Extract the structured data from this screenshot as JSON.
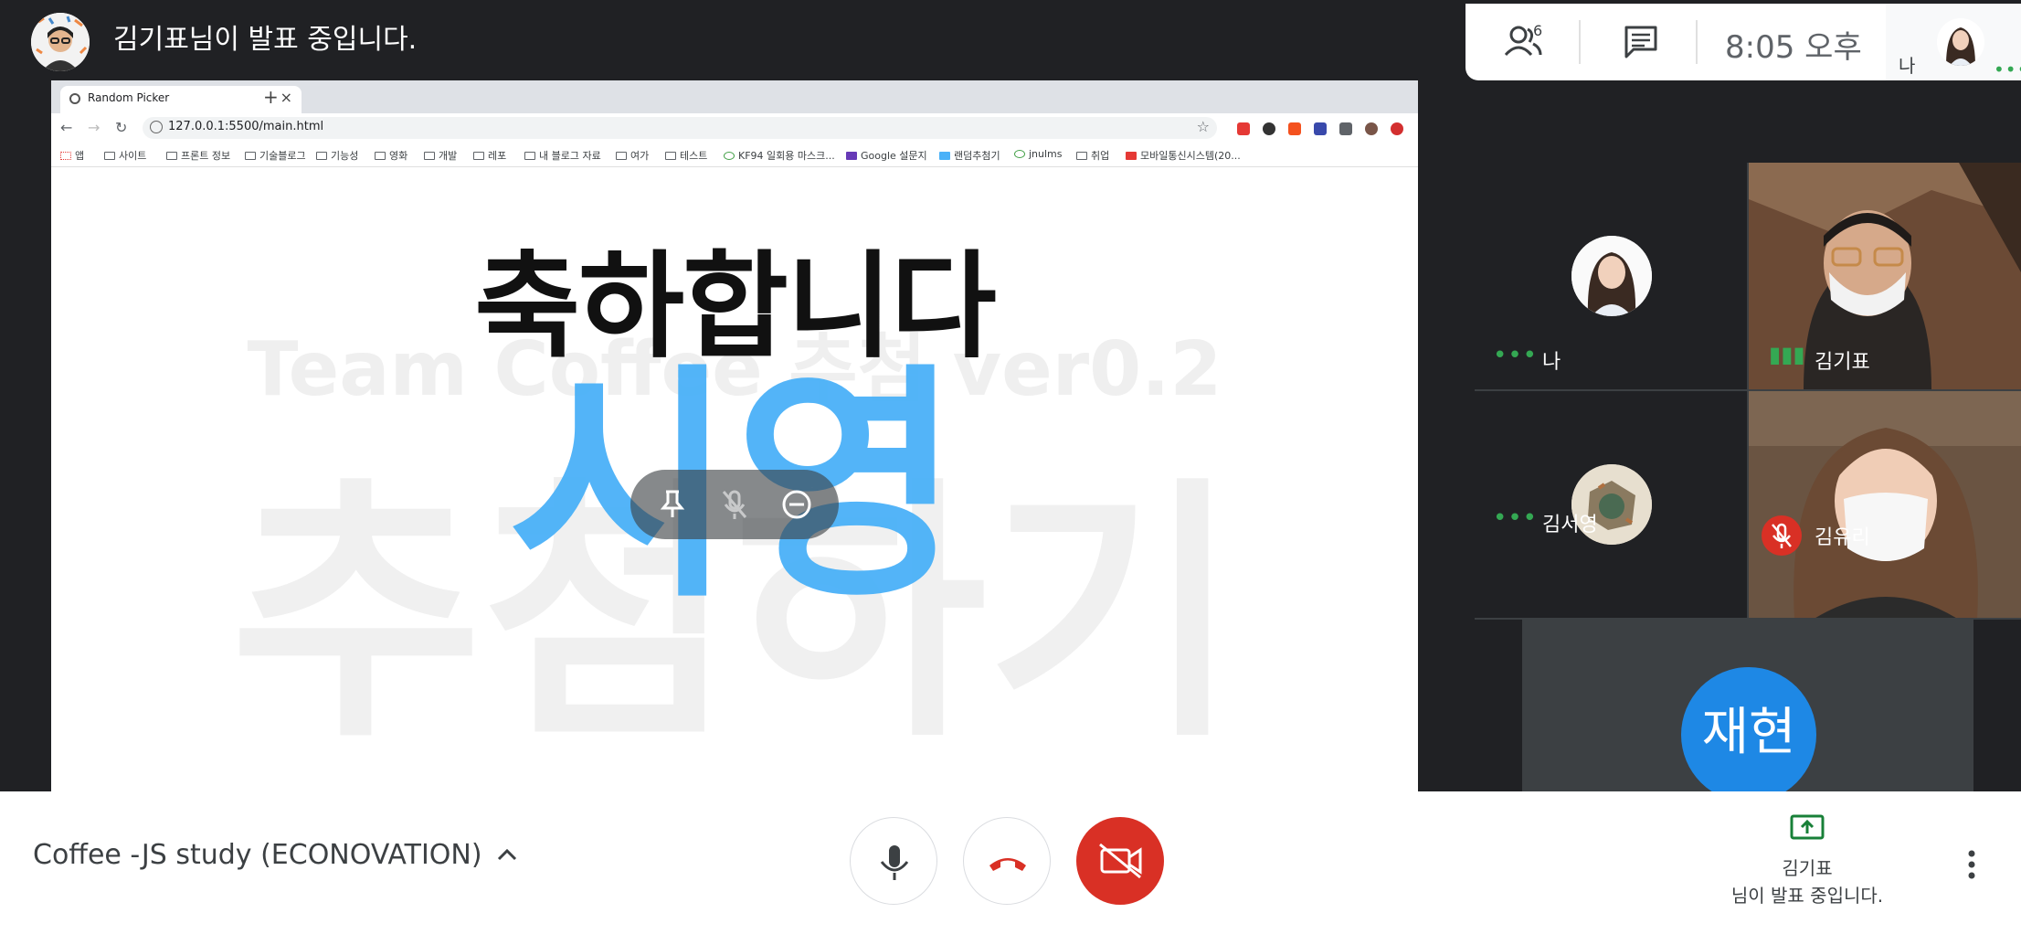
{
  "presenter": {
    "banner": "김기표님이 발표 중입니다."
  },
  "top_panel": {
    "people_count": "6",
    "clock": "8:05 오후",
    "self_label": "나"
  },
  "browser": {
    "tab_title": "Random Picker",
    "tab_close": "×",
    "new_tab": "+",
    "url": "127.0.0.1:5500/main.html",
    "bookmarks": [
      "앱",
      "사이트",
      "프론트 정보",
      "기술블로그",
      "기능성",
      "영화",
      "개발",
      "레포",
      "내 블로그 자료",
      "여가",
      "테스트",
      "KF94 일회용 마스크...",
      "Google 설문지",
      "랜덤추첨기",
      "jnulms",
      "취업",
      "모바일통신시스템(20..."
    ]
  },
  "slide": {
    "heading": "축하합니다",
    "subtitle": "Team Coffee 추첨 ver0.2",
    "background_text": "추첨하기",
    "winner": "시영"
  },
  "participants": [
    {
      "name": "나",
      "video": false,
      "muted": false
    },
    {
      "name": "김기표",
      "video": true,
      "muted": false,
      "speaking": true
    },
    {
      "name": "김서영",
      "video": false,
      "muted": false
    },
    {
      "name": "김유리",
      "video": true,
      "muted": true
    }
  ],
  "extra_participant": {
    "initials": "재현"
  },
  "bottom_bar": {
    "meeting_title": "Coffee -JS study (ECONOVATION)",
    "presenting_name": "김기표",
    "presenting_status": "님이 발표 중입니다."
  },
  "colors": {
    "accent_blue": "#4ab1f8",
    "danger_red": "#d93025",
    "meet_green": "#34a853",
    "dark_bg": "#202124",
    "tile_bg": "#3c4043"
  }
}
